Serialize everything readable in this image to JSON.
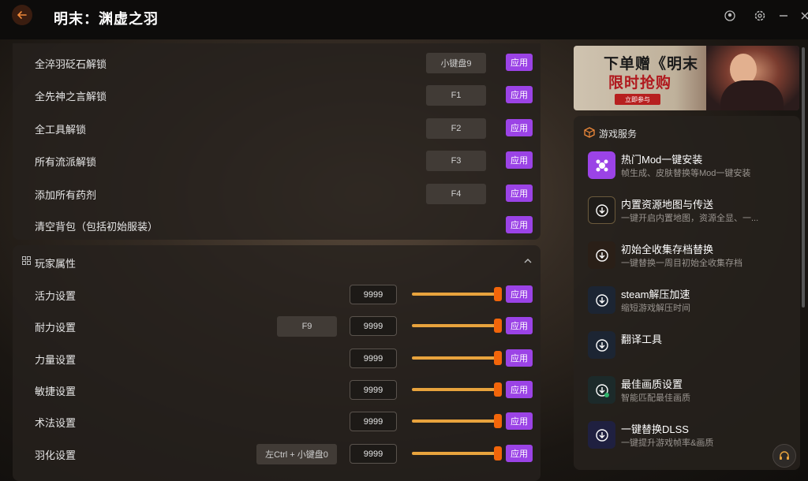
{
  "app": {
    "title": "明末：渊虚之羽"
  },
  "titlebar_icons": [
    "user-icon",
    "settings-icon",
    "minimize-icon",
    "close-icon"
  ],
  "unlocks": [
    {
      "label": "全淬羽砭石解锁",
      "key": "小键盘9",
      "apply": "应用"
    },
    {
      "label": "全先神之言解锁",
      "key": "F1",
      "apply": "应用"
    },
    {
      "label": "全工具解锁",
      "key": "F2",
      "apply": "应用"
    },
    {
      "label": "所有流派解锁",
      "key": "F3",
      "apply": "应用"
    },
    {
      "label": "添加所有药剂",
      "key": "F4",
      "apply": "应用"
    },
    {
      "label": "清空背包（包括初始服装）",
      "key": "",
      "apply": "应用"
    }
  ],
  "player_section": {
    "title": "玩家属性"
  },
  "attributes": [
    {
      "label": "活力设置",
      "key": "",
      "value": "9999",
      "apply": "应用"
    },
    {
      "label": "耐力设置",
      "key": "F9",
      "value": "9999",
      "apply": "应用"
    },
    {
      "label": "力量设置",
      "key": "",
      "value": "9999",
      "apply": "应用"
    },
    {
      "label": "敏捷设置",
      "key": "",
      "value": "9999",
      "apply": "应用"
    },
    {
      "label": "术法设置",
      "key": "",
      "value": "9999",
      "apply": "应用"
    },
    {
      "label": "羽化设置",
      "key": "左Ctrl + 小键盘0",
      "value": "9999",
      "apply": "应用"
    }
  ],
  "banner": {
    "title": "下单赠《明末",
    "subtitle": "限时抢购",
    "tag": "立即参与"
  },
  "services": {
    "title": "游戏服务",
    "items": [
      {
        "title": "热门Mod一键安装",
        "desc": "帧生成、皮肤替换等Mod一键安装",
        "icon": "mod-icon",
        "color": "#9b43e6"
      },
      {
        "title": "内置资源地图与传送",
        "desc": "一键开启内置地图，资源全显、一...",
        "icon": "download-icon",
        "color": "#1f1c19"
      },
      {
        "title": "初始全收集存档替换",
        "desc": "一键替换一周目初始全收集存档",
        "icon": "download-icon",
        "color": "#2a1f17"
      },
      {
        "title": "steam解压加速",
        "desc": "缩短游戏解压时间",
        "icon": "download-icon",
        "color": "#1c2533"
      },
      {
        "title": "翻译工具",
        "desc": "",
        "icon": "download-icon",
        "color": "#1c2533"
      },
      {
        "title": "最佳画质设置",
        "desc": "智能匹配最佳画质",
        "icon": "download-icon",
        "color": "#1c2a2a"
      },
      {
        "title": "一键替换DLSS",
        "desc": "一键提升游戏帧率&画质",
        "icon": "download-icon",
        "color": "#1f2040"
      }
    ]
  }
}
